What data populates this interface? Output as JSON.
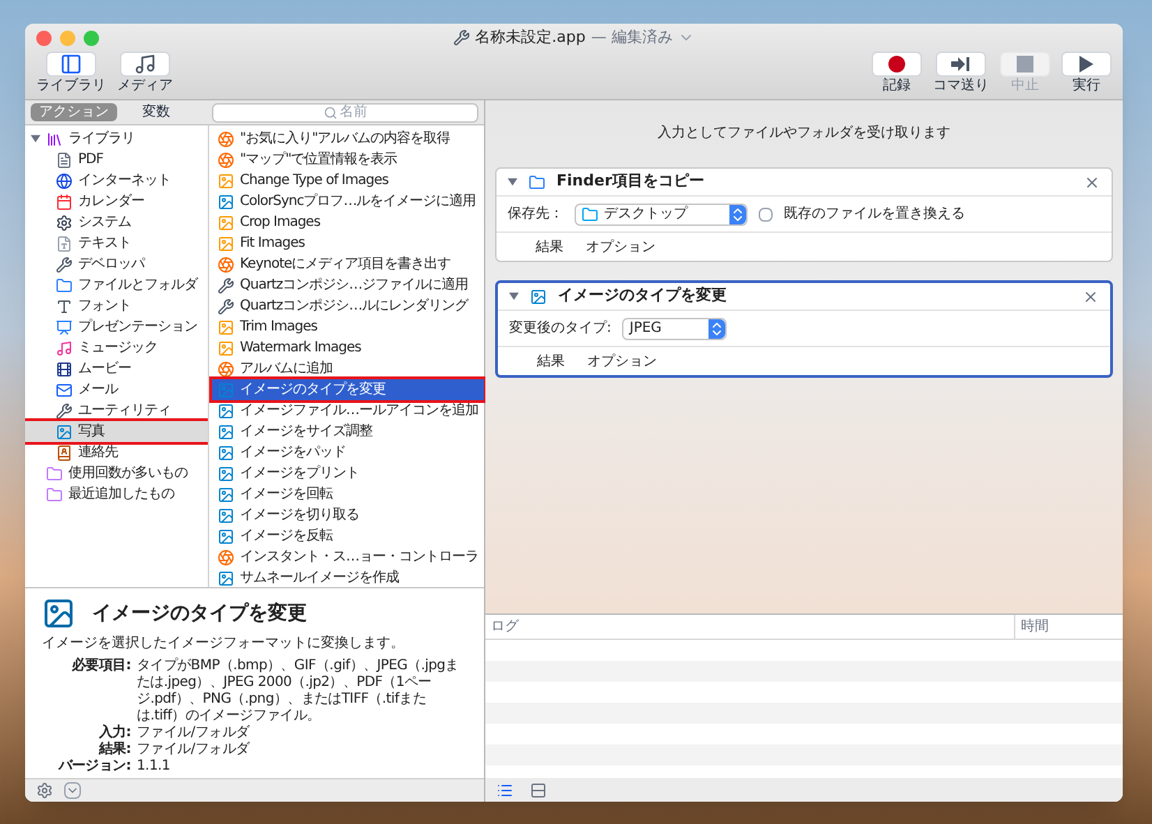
{
  "window": {
    "title": "名称未設定.app",
    "status": "— 編集済み"
  },
  "toolbar_left": [
    {
      "label": "ライブラリ",
      "kind": "library"
    },
    {
      "label": "メディア",
      "kind": "media"
    }
  ],
  "toolbar_right": [
    {
      "label": "記録",
      "kind": "record",
      "disabled": false
    },
    {
      "label": "コマ送り",
      "kind": "step",
      "disabled": false
    },
    {
      "label": "中止",
      "kind": "stop",
      "disabled": true
    },
    {
      "label": "実行",
      "kind": "run",
      "disabled": false
    }
  ],
  "tabs": [
    {
      "label": "アクション",
      "selected": true
    },
    {
      "label": "変数",
      "selected": false
    }
  ],
  "search": {
    "placeholder": "名前"
  },
  "library": [
    {
      "label": "ライブラリ",
      "kind": "library",
      "expanded": true,
      "selected": false,
      "annotated": false,
      "children": [
        {
          "label": "PDF",
          "kind": "pdf",
          "selected": false,
          "annotated": false
        },
        {
          "label": "インターネット",
          "kind": "internet",
          "selected": false,
          "annotated": false
        },
        {
          "label": "カレンダー",
          "kind": "calendar",
          "selected": false,
          "annotated": false
        },
        {
          "label": "システム",
          "kind": "system",
          "selected": false,
          "annotated": false
        },
        {
          "label": "テキスト",
          "kind": "text",
          "selected": false,
          "annotated": false
        },
        {
          "label": "デベロッパ",
          "kind": "tools",
          "selected": false,
          "annotated": false
        },
        {
          "label": "ファイルとフォルダ",
          "kind": "finder",
          "selected": false,
          "annotated": false
        },
        {
          "label": "フォント",
          "kind": "font",
          "selected": false,
          "annotated": false
        },
        {
          "label": "プレゼンテーション",
          "kind": "presentation",
          "selected": false,
          "annotated": false
        },
        {
          "label": "ミュージック",
          "kind": "music",
          "selected": false,
          "annotated": false
        },
        {
          "label": "ムービー",
          "kind": "movie",
          "selected": false,
          "annotated": false
        },
        {
          "label": "メール",
          "kind": "mail",
          "selected": false,
          "annotated": false
        },
        {
          "label": "ユーティリティ",
          "kind": "tools",
          "selected": false,
          "annotated": false
        },
        {
          "label": "写真",
          "kind": "photo",
          "selected": true,
          "annotated": true
        },
        {
          "label": "連絡先",
          "kind": "contacts",
          "selected": false,
          "annotated": false
        }
      ]
    },
    {
      "label": "使用回数が多いもの",
      "kind": "smart",
      "selected": false,
      "annotated": false
    },
    {
      "label": "最近追加したもの",
      "kind": "smart",
      "selected": false,
      "annotated": false
    }
  ],
  "actions": [
    {
      "label": "\"お気に入り\"アルバムの内容を取得",
      "kind": "photos",
      "selected": false,
      "annotated": false
    },
    {
      "label": "\"マップ\"で位置情報を表示",
      "kind": "photos",
      "selected": false,
      "annotated": false
    },
    {
      "label": "Change Type of Images",
      "kind": "preview",
      "selected": false,
      "annotated": false
    },
    {
      "label": "ColorSyncプロフ…ルをイメージに適用",
      "kind": "image",
      "selected": false,
      "annotated": false
    },
    {
      "label": "Crop Images",
      "kind": "preview",
      "selected": false,
      "annotated": false
    },
    {
      "label": "Fit Images",
      "kind": "preview",
      "selected": false,
      "annotated": false
    },
    {
      "label": "Keynoteにメディア項目を書き出す",
      "kind": "photos",
      "selected": false,
      "annotated": false
    },
    {
      "label": "Quartzコンポジシ…ジファイルに適用",
      "kind": "tools",
      "selected": false,
      "annotated": false
    },
    {
      "label": "Quartzコンポジシ…ルにレンダリング",
      "kind": "tools",
      "selected": false,
      "annotated": false
    },
    {
      "label": "Trim Images",
      "kind": "preview",
      "selected": false,
      "annotated": false
    },
    {
      "label": "Watermark Images",
      "kind": "preview",
      "selected": false,
      "annotated": false
    },
    {
      "label": "アルバムに追加",
      "kind": "photos",
      "selected": false,
      "annotated": false
    },
    {
      "label": "イメージのタイプを変更",
      "kind": "image",
      "selected": true,
      "annotated": true
    },
    {
      "label": "イメージファイル…ールアイコンを追加",
      "kind": "image",
      "selected": false,
      "annotated": false
    },
    {
      "label": "イメージをサイズ調整",
      "kind": "image",
      "selected": false,
      "annotated": false
    },
    {
      "label": "イメージをパッド",
      "kind": "image",
      "selected": false,
      "annotated": false
    },
    {
      "label": "イメージをプリント",
      "kind": "image",
      "selected": false,
      "annotated": false
    },
    {
      "label": "イメージを回転",
      "kind": "image",
      "selected": false,
      "annotated": false
    },
    {
      "label": "イメージを切り取る",
      "kind": "image",
      "selected": false,
      "annotated": false
    },
    {
      "label": "イメージを反転",
      "kind": "image",
      "selected": false,
      "annotated": false
    },
    {
      "label": "インスタント・ス…ョー・コントローラ",
      "kind": "photos",
      "selected": false,
      "annotated": false
    },
    {
      "label": "サムネールイメージを作成",
      "kind": "image",
      "selected": false,
      "annotated": false
    }
  ],
  "description": {
    "title": "イメージのタイプを変更",
    "summary": "イメージを選択したイメージフォーマットに変換します。",
    "fields": [
      {
        "label": "必要項目:",
        "value": "タイプがBMP（.bmp）、GIF（.gif）、JPEG（.jpgまたは.jpeg）、JPEG 2000（.jp2）、PDF（1ページ.pdf）、PNG（.png）、またはTIFF（.tifまたは.tiff）のイメージファイル。"
      },
      {
        "label": "入力:",
        "value": "ファイル/フォルダ"
      },
      {
        "label": "結果:",
        "value": "ファイル/フォルダ"
      },
      {
        "label": "バージョン:",
        "value": "1.1.1"
      }
    ]
  },
  "workflow": {
    "input_note": "入力としてファイルやフォルダを受け取ります",
    "steps": [
      {
        "title": "Finder項目をコピー",
        "kind": "finder",
        "selected": false,
        "expanded": true,
        "field_label": "保存先：",
        "popup": {
          "value": "デスクトップ",
          "kind": "folder"
        },
        "checkbox": {
          "label": "既存のファイルを置き換える",
          "checked": false
        },
        "footer": [
          "結果",
          "オプション"
        ]
      },
      {
        "title": "イメージのタイプを変更",
        "kind": "image",
        "selected": true,
        "expanded": true,
        "field_label": "変更後のタイプ:",
        "popup": {
          "value": "JPEG",
          "kind": "plain"
        },
        "footer": [
          "結果",
          "オプション"
        ]
      }
    ]
  },
  "log": {
    "columns": [
      "ログ",
      "時間"
    ]
  }
}
